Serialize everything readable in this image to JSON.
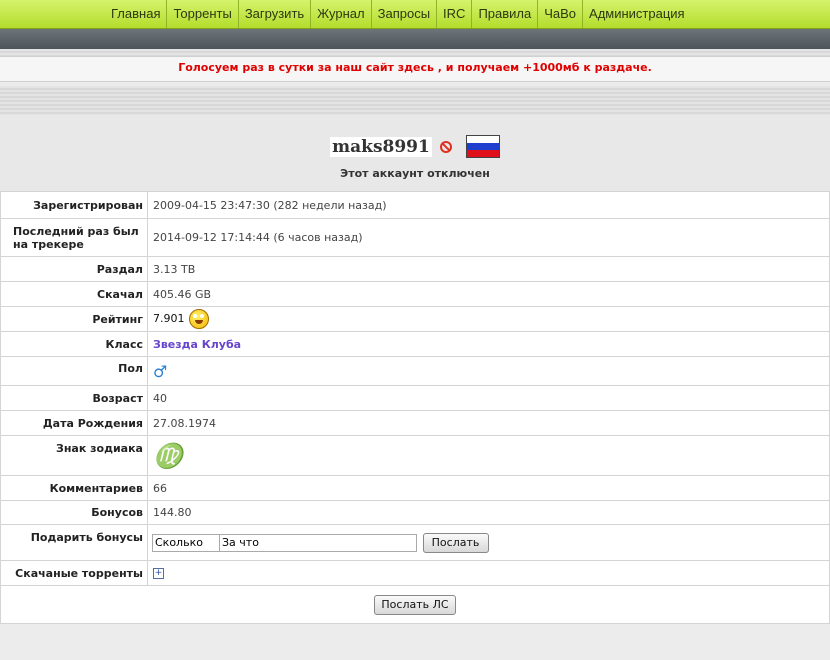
{
  "nav": [
    "Главная",
    "Торренты",
    "Загрузить",
    "Журнал",
    "Запросы",
    "IRC",
    "Правила",
    "ЧаВо",
    "Администрация"
  ],
  "notice": "Голосуем раз в сутки за наш сайт здесь , и получаем +1000мб к раздаче.",
  "profile": {
    "username": "maks8991",
    "status": "Этот аккаунт отключен",
    "flag": "russia-flag",
    "rows": {
      "registered": {
        "label": "Зарегистрирован",
        "value": "2009-04-15 23:47:30 (282 недели назад)"
      },
      "last_seen": {
        "label": "Последний раз был на трекере",
        "value": "2014-09-12 17:14:44 (6 часов назад)"
      },
      "uploaded": {
        "label": "Раздал",
        "value": "3.13 TB"
      },
      "downloaded": {
        "label": "Скачал",
        "value": "405.46 GB"
      },
      "ratio": {
        "label": "Рейтинг",
        "value": "7.901"
      },
      "class": {
        "label": "Класс",
        "value": "Звезда Клуба"
      },
      "gender": {
        "label": "Пол",
        "value": "♂"
      },
      "age": {
        "label": "Возраст",
        "value": "40"
      },
      "birthday": {
        "label": "Дата Рождения",
        "value": "27.08.1974"
      },
      "zodiac": {
        "label": "Знак зодиака",
        "value": "♍"
      },
      "comments": {
        "label": "Комментариев",
        "value": "66"
      },
      "bonus": {
        "label": "Бонусов",
        "value": "144.80"
      },
      "gift": {
        "label": "Подарить бонусы",
        "amount_value": "Сколько",
        "reason_value": "За что",
        "button": "Послать"
      },
      "downloads": {
        "label": "Скачаные торренты"
      }
    },
    "send_pm": "Послать ЛС"
  },
  "colors": {
    "nav_bg": "#c4e84a",
    "notice_text": "#e00000",
    "class_color": "#6644cc"
  }
}
